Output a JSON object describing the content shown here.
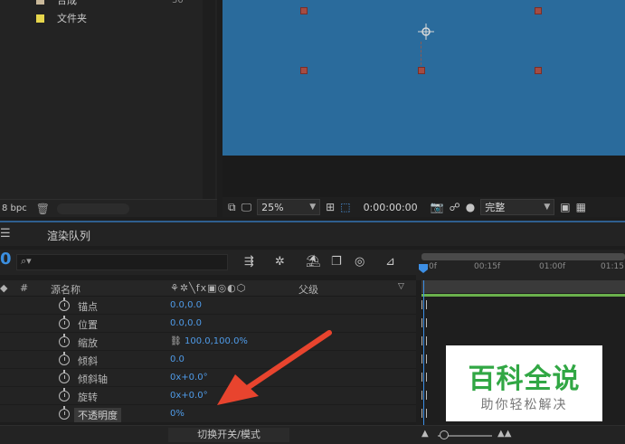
{
  "project": {
    "items": [
      {
        "name": "合成",
        "count": "30",
        "color": "#c9b89a"
      },
      {
        "name": "文件夹",
        "count": "",
        "color": "#e6d64c"
      }
    ],
    "bpc": "8 bpc"
  },
  "viewer": {
    "zoom": "25%",
    "timecode": "0:00:00:00",
    "quality": "完整",
    "colors": {
      "canvas": "#2a6b9c",
      "handle": "#a44c43"
    }
  },
  "timeline": {
    "tab_label": "渲染队列",
    "current_time": "0",
    "search_placeholder": "",
    "columns": {
      "hash": "#",
      "source_name": "源名称",
      "parent": "父级"
    },
    "ruler_ticks": [
      "0f",
      "00:15f",
      "01:00f",
      "01:15"
    ],
    "properties": [
      {
        "name": "锚点",
        "value": "0.0,0.0"
      },
      {
        "name": "位置",
        "value": "0.0,0.0"
      },
      {
        "name": "缩放",
        "value": "100.0,100.0%",
        "linked": true
      },
      {
        "name": "倾斜",
        "value": "0.0"
      },
      {
        "name": "倾斜轴",
        "value": "0x+0.0°"
      },
      {
        "name": "旋转",
        "value": "0x+0.0°"
      },
      {
        "name": "不透明度",
        "value": "0%",
        "selected": true
      }
    ],
    "toggle_label": "切换开关/模式"
  },
  "watermark": {
    "title": "百科全说",
    "subtitle": "助你轻松解决",
    "color": "#31a744"
  },
  "annotation": {
    "arrow_color": "#e8442e"
  }
}
